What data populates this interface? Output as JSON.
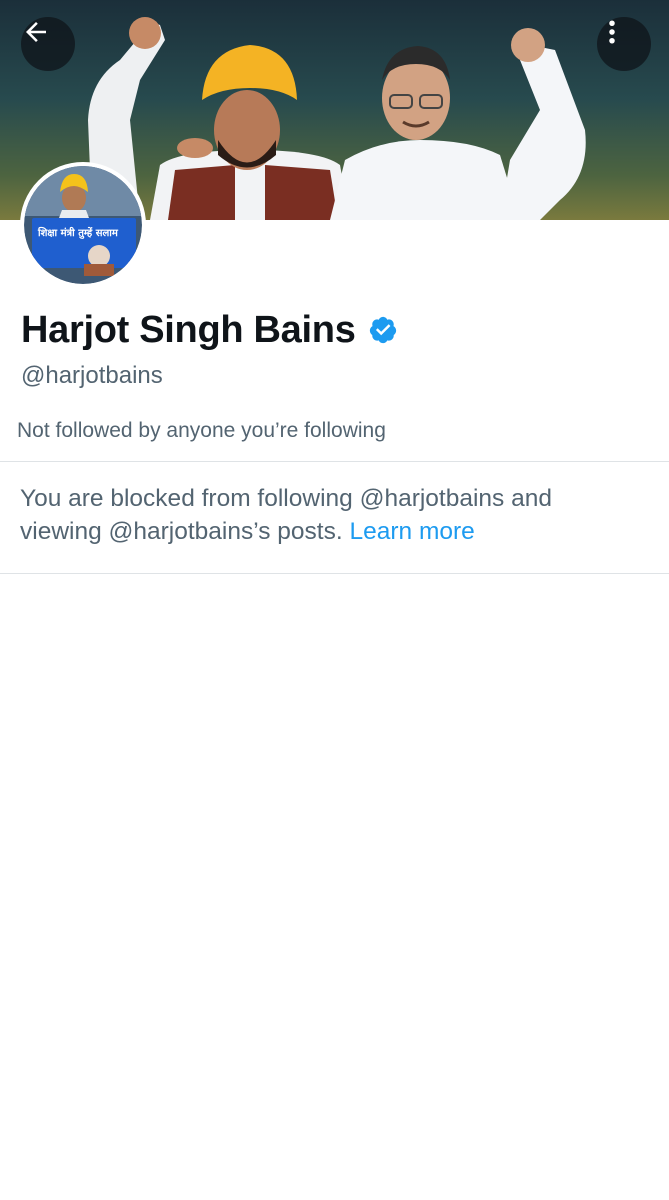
{
  "profile": {
    "display_name": "Harjot Singh Bains",
    "handle": "@harjotbains",
    "follow_context": "Not followed by anyone you’re following",
    "verified": true,
    "avatar_banner_text": "शिक्षा मंत्री तुम्हें सलाम"
  },
  "header": {
    "back_icon": "arrow-left-icon",
    "more_icon": "more-vertical-icon"
  },
  "notice": {
    "blocked_text": "You are blocked from following @harjotbains and viewing @harjotbains’s posts.",
    "learn_more": "Learn more"
  },
  "colors": {
    "accent": "#1d9bf0",
    "primary_text": "#0f1419",
    "secondary_text": "#536471",
    "verified_badge": "#1d9bf0"
  }
}
